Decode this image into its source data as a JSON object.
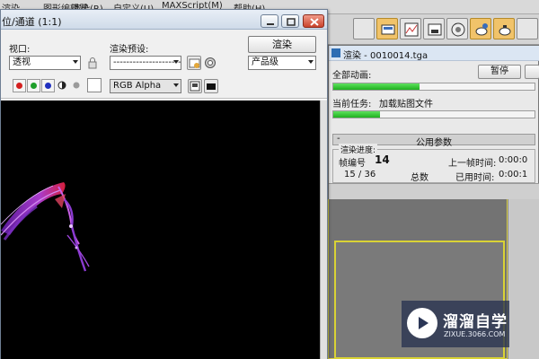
{
  "max_menubar": {
    "items": [
      "渲染",
      "图形编辑器",
      "渲染(R)",
      "自定义(U)",
      "MAXScript(M)",
      "帮助(H)"
    ]
  },
  "frame_buffer": {
    "title": "位/通道 (1:1)",
    "viewport_label": "视口:",
    "viewport_value": "透视",
    "render_preset_label": "渲染预设:",
    "render_preset_value": "-------------------------",
    "render_button": "渲染",
    "quality_value": "产品级",
    "channel_value": "RGB Alpha",
    "colors": {
      "red": "#d42020",
      "green": "#1e9e2a",
      "blue": "#1f2fbf",
      "mono": "#222222"
    }
  },
  "progress_dialog": {
    "title": "渲染 - 0010014.tga",
    "all_anim_label": "全部动画:",
    "pause_button": "暂停",
    "current_task_label": "当前任务:",
    "current_task_value": "加载贴图文件",
    "all_anim_progress": 0.43,
    "current_task_progress": 0.23,
    "rollout_title": "公用参数",
    "group_title": "渲染进度:",
    "frame_label": "帧编号",
    "frame_value": "14",
    "count_value": "15 / 36",
    "total_label": "总数",
    "last_frame_time_label": "上一帧时间:",
    "last_frame_time_value": "0:00:0",
    "elapsed_label": "已用时间:",
    "elapsed_value": "0:00:1"
  },
  "watermark": {
    "brand": "溜溜自学",
    "url": "ZIXUE.3066.COM"
  }
}
